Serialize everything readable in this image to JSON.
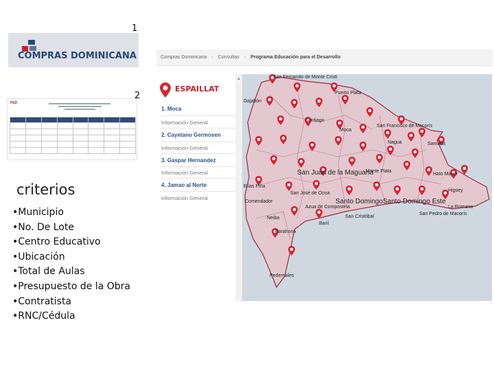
{
  "labels": {
    "one": "1",
    "two": "2"
  },
  "logo": {
    "text": "COMPRAS DOMINICANA",
    "brand_colors": [
      "#27477a",
      "#c8202f"
    ]
  },
  "document_thumbnail": {
    "logo_text": "PED"
  },
  "criterios": {
    "title": "criterios",
    "items": [
      "•Municipio",
      "•No. De Lote",
      "•Centro Educativo",
      "•Ubicación",
      "•Total de Aulas",
      "•Presupuesto de la Obra",
      "•Contratista",
      "•RNC/Cédula"
    ]
  },
  "breadcrumb": {
    "items": [
      "Compras Dominicana",
      "Consultas",
      "Programa Educación para el Desarrollo"
    ]
  },
  "province_panel": {
    "title": "ESPAILLAT",
    "icon": "map-pin-icon",
    "municipalities": [
      {
        "name": "1. Moca",
        "link": "Información General"
      },
      {
        "name": "2. Cayetano Germosen",
        "link": "Información General"
      },
      {
        "name": "3. Gaspar Hernandez",
        "link": "Información General"
      },
      {
        "name": "4. Jamao al Norte",
        "link": "Información General"
      }
    ]
  },
  "map": {
    "labels": [
      "San Fernando de Monte Cristi",
      "Puerto Plata",
      "Dajabón",
      "Santiago",
      "Moca",
      "San Francisco de Macorís",
      "Nagua",
      "Samaná",
      "Monte Plata",
      "Hato Mayor",
      "San Juan de la Maguana",
      "Santo Domingo",
      "Santo Domingo Este",
      "La Romana",
      "Azua de Compostela",
      "Baní",
      "Barahona",
      "Pedernales",
      "Elías Piña",
      "San Cristóbal",
      "Higüey",
      "San Pedro de Macorís",
      "Neiba",
      "Comendador",
      "San José de Ocoa"
    ],
    "colors": {
      "territory": "#e3c8cf",
      "border": "#9b2b3c",
      "sea": "#cfd8e0",
      "pin": "#d92332"
    }
  }
}
